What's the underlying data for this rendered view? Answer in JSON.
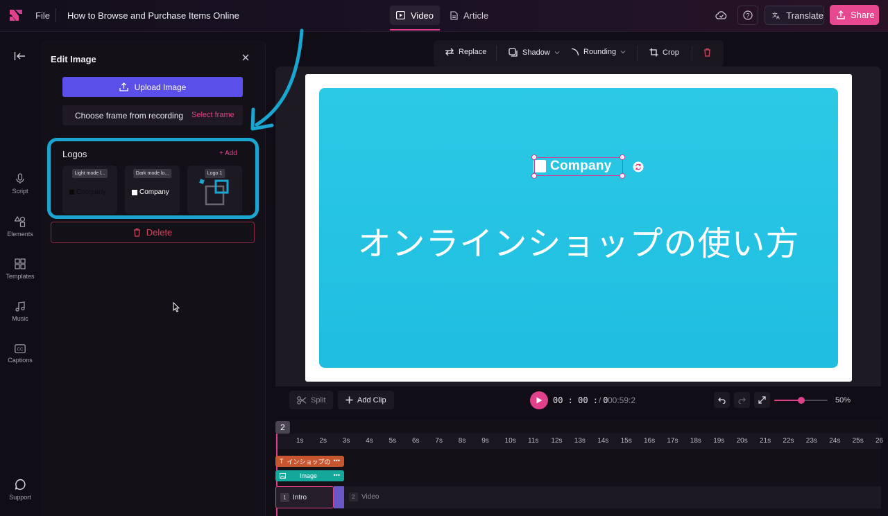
{
  "topbar": {
    "menu_file": "File",
    "doc_title": "How to Browse and Purchase Items Online",
    "tabs": [
      {
        "label": "Video",
        "active": true,
        "icon": "play-square-icon"
      },
      {
        "label": "Article",
        "active": false,
        "icon": "document-icon"
      }
    ],
    "translate_label": "Translate",
    "share_label": "Share"
  },
  "rail": {
    "items": [
      {
        "label": "Script",
        "icon": "microphone-icon"
      },
      {
        "label": "Elements",
        "icon": "shapes-icon"
      },
      {
        "label": "Templates",
        "icon": "grid-icon"
      },
      {
        "label": "Music",
        "icon": "music-note-icon"
      },
      {
        "label": "Captions",
        "icon": "cc-icon"
      }
    ],
    "support_label": "Support"
  },
  "panel": {
    "title": "Edit Image",
    "upload_label": "Upload Image",
    "frame_label": "Choose frame from recording",
    "frame_link": "Select frame",
    "logos": {
      "title": "Logos",
      "add_label": "+ Add",
      "cards": [
        {
          "label": "Light mode l...",
          "text": "Company"
        },
        {
          "label": "Dark mode lo...",
          "text": "Company"
        },
        {
          "label": "Logo 1",
          "text": ""
        }
      ]
    },
    "delete_label": "Delete"
  },
  "canvas_toolbar": {
    "replace": "Replace",
    "shadow": "Shadow",
    "rounding": "Rounding",
    "crop": "Crop"
  },
  "slide": {
    "company_text": "Company",
    "heading": "オンラインショップの使い方",
    "bg_color": "#22c3e3"
  },
  "playback": {
    "split": "Split",
    "add_clip": "Add Clip",
    "time_current": "00 : 00 :  0",
    "time_sep": "/",
    "time_total": "00:59:2",
    "zoom_percent": "50%",
    "zoom_level": 0.5
  },
  "timeline": {
    "playhead": "2",
    "ticks": [
      "1s",
      "2s",
      "3s",
      "4s",
      "5s",
      "6s",
      "7s",
      "8s",
      "9s",
      "10s",
      "11s",
      "12s",
      "13s",
      "14s",
      "15s",
      "16s",
      "17s",
      "18s",
      "19s",
      "20s",
      "21s",
      "22s",
      "23s",
      "24s",
      "25s",
      "26"
    ],
    "text_track": "インショップの",
    "image_track": "Image",
    "scenes": [
      {
        "num": "1",
        "label": "Intro"
      },
      {
        "num": "2",
        "label": "Video"
      }
    ]
  },
  "colors": {
    "accent": "#e0418a",
    "primary_button": "#5a4fe8",
    "highlight_border": "#1aa6d0",
    "slide_bg": "#22c3e3"
  }
}
